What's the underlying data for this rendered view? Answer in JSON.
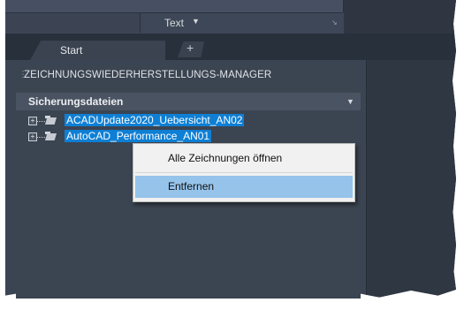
{
  "ribbon": {
    "text_panel_label": "Text",
    "text_panel_caret": "▼",
    "launcher_icon": "↘"
  },
  "tabs": {
    "start_label": "Start",
    "add_label": "+"
  },
  "panel": {
    "grip": "⋮",
    "title": "ZEICHNUNGSWIEDERHERSTELLUNGS-MANAGER",
    "section_label": "Sicherungsdateien",
    "section_caret": "▼",
    "files": [
      {
        "label": "ACADUpdate2020_Uebersicht_AN02",
        "expander": "+"
      },
      {
        "label": "AutoCAD_Performance_AN01",
        "expander": "+"
      }
    ]
  },
  "context_menu": {
    "items": [
      {
        "label": "Alle Zeichnungen öffnen"
      },
      {
        "label": "Entfernen"
      }
    ]
  },
  "colors": {
    "selection": "#0e7fd4",
    "menu_highlight": "#95c3ea",
    "panel_bg": "#3b4451"
  }
}
